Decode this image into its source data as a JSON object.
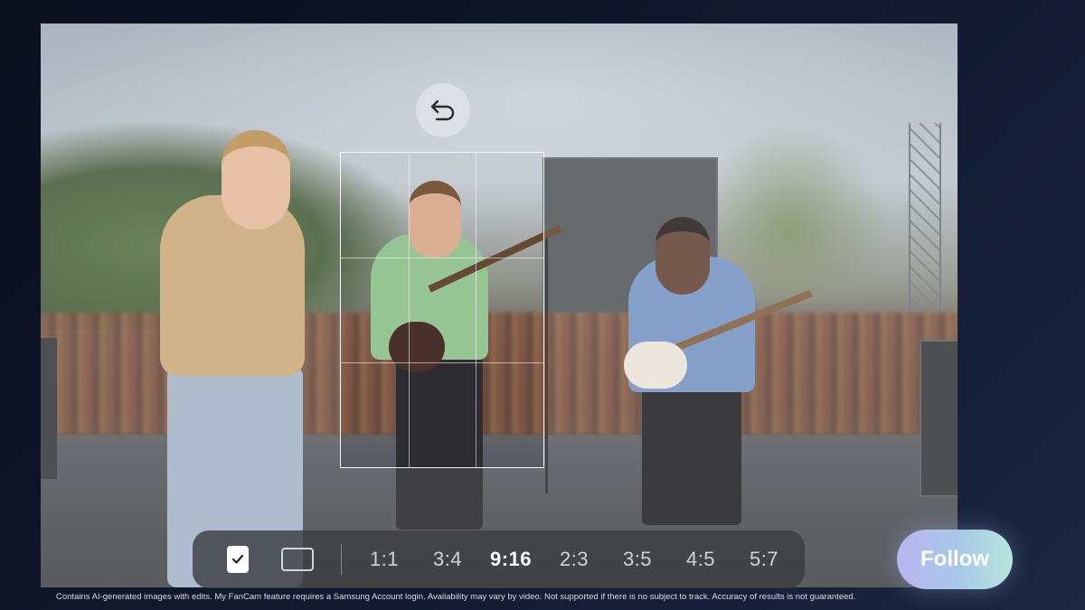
{
  "undo": {
    "icon": "undo-arrow-icon"
  },
  "toolbar": {
    "icons": [
      "checkmark-icon",
      "wide-frame-icon"
    ],
    "ratios": [
      "1:1",
      "3:4",
      "9:16",
      "2:3",
      "3:5",
      "4:5",
      "5:7"
    ],
    "selected_ratio": "9:16"
  },
  "follow_button": {
    "label": "Follow"
  },
  "disclaimer": "Contains AI-generated images with edits. My FanCam feature requires a Samsung Account login. Availability may vary by video. Not supported if there is no subject to track. Accuracy of results is not guaranteed.",
  "colors": {
    "follow_gradient_start": "#b8b5f0",
    "follow_gradient_end": "#b7e6dd",
    "toolbar_bg": "#3c3e42"
  }
}
